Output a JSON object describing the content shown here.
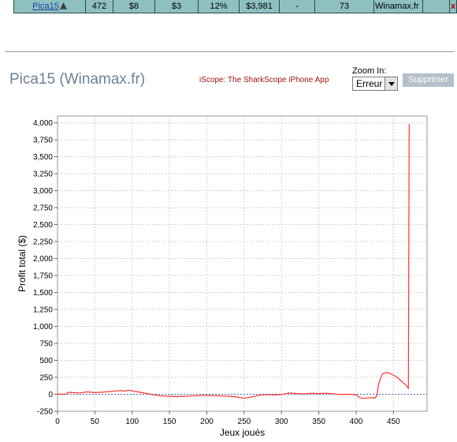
{
  "top_row": {
    "player": "Pica15",
    "cells": [
      "472",
      "$8",
      "$3",
      "12%",
      "$3,981",
      "-",
      "73",
      "Winamax.fr"
    ],
    "remove_label": "x"
  },
  "header": {
    "title": "Pica15 (Winamax.fr)",
    "iscope_link": "iScope: The SharkScope iPhone App",
    "zoom_label": "Zoom In:",
    "zoom_value": "Erreur",
    "delete_label": "Supprimer"
  },
  "colors": {
    "table_bg": "#8fc0c0",
    "line": "#ff3030",
    "title": "#6e8191",
    "delete_bg": "#b4bfc9"
  },
  "chart_data": {
    "type": "line",
    "xlabel": "Jeux joués",
    "ylabel": "Profit total ($)",
    "xlim": [
      0,
      495
    ],
    "ylim": [
      -250,
      4100
    ],
    "xticks": [
      0,
      50,
      100,
      150,
      200,
      250,
      300,
      350,
      400,
      450
    ],
    "yticks": [
      -250,
      0,
      250,
      500,
      750,
      1000,
      1250,
      1500,
      1750,
      2000,
      2250,
      2500,
      2750,
      3000,
      3250,
      3500,
      3750,
      4000
    ],
    "xtick_labels": [
      "0",
      "50",
      "100",
      "150",
      "200",
      "250",
      "300",
      "350",
      "400",
      "450"
    ],
    "ytick_labels": [
      "-250",
      "0",
      "250",
      "500",
      "750",
      "1,000",
      "1,250",
      "1,500",
      "1,750",
      "2,000",
      "2,250",
      "2,500",
      "2,750",
      "3,000",
      "3,250",
      "3,500",
      "3,750",
      "4,000"
    ],
    "grid": true,
    "series": [
      {
        "color": "#ff3030",
        "x": [
          0,
          5,
          10,
          15,
          20,
          30,
          40,
          50,
          60,
          70,
          80,
          85,
          90,
          95,
          100,
          110,
          120,
          130,
          140,
          150,
          160,
          170,
          180,
          190,
          200,
          210,
          220,
          230,
          240,
          250,
          255,
          260,
          270,
          280,
          290,
          300,
          310,
          320,
          330,
          340,
          350,
          360,
          370,
          380,
          390,
          400,
          405,
          410,
          420,
          425,
          428,
          430,
          435,
          440,
          445,
          450,
          455,
          460,
          465,
          468,
          469,
          470,
          471
        ],
        "y": [
          0,
          5,
          -5,
          30,
          25,
          20,
          35,
          25,
          30,
          40,
          50,
          55,
          45,
          60,
          50,
          30,
          10,
          -10,
          -25,
          -30,
          -35,
          -30,
          -25,
          -20,
          -15,
          -20,
          -25,
          -30,
          -40,
          -60,
          -50,
          -40,
          -15,
          -5,
          -10,
          -5,
          20,
          10,
          5,
          15,
          10,
          15,
          5,
          -5,
          0,
          -10,
          -50,
          -60,
          -50,
          -55,
          -20,
          150,
          300,
          320,
          310,
          280,
          250,
          200,
          150,
          120,
          100,
          90,
          3981
        ]
      }
    ]
  }
}
